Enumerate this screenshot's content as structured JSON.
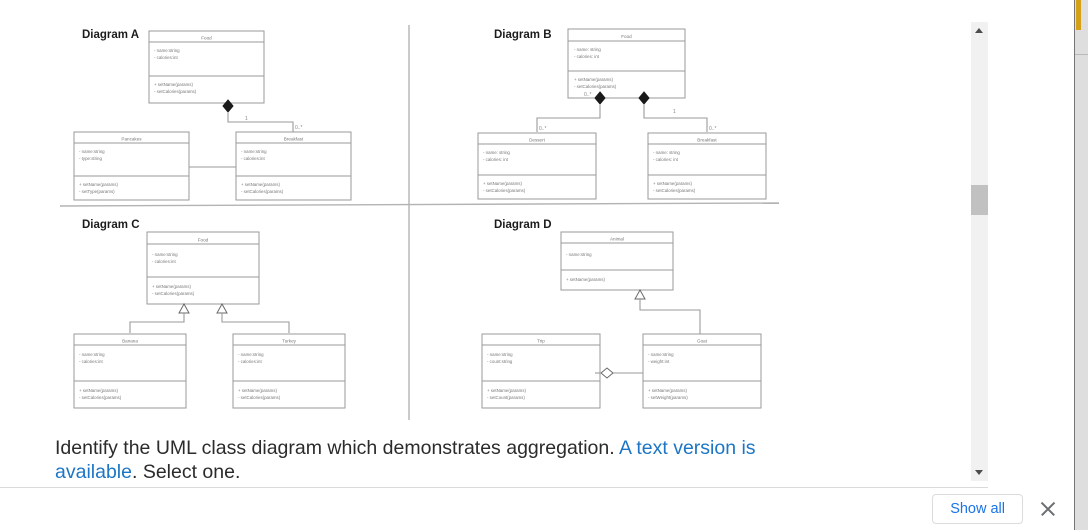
{
  "question": {
    "text_before": "Identify the UML class diagram which demonstrates aggregation. ",
    "link_text": "A text version is available",
    "text_after": ". Select one."
  },
  "bottom_bar": {
    "show_all_label": "Show all",
    "close_icon": "close-icon"
  },
  "scrollbar": {
    "up_icon": "scroll-up-arrow-icon",
    "down_icon": "scroll-down-arrow-icon"
  },
  "colors": {
    "link": "#1d76c5",
    "button_text": "#1a73e8",
    "diagram_stroke": "#808080",
    "text": "#2b2b2b",
    "scrollbar_track": "#f1f1f1",
    "scrollbar_thumb": "#c1c1c1",
    "find_marker": "#d4a017"
  },
  "figure": {
    "diagrams": [
      {
        "id": "A",
        "title": "Diagram A",
        "relationship": "composition",
        "classes": [
          {
            "name": "Food",
            "attributes": [
              "- name:string",
              "- calories:int"
            ],
            "methods": [
              "+ setName(params)",
              "- setCalories(params)"
            ]
          },
          {
            "name": "Pancakes",
            "attributes": [
              "- name:string",
              "- type:string"
            ],
            "methods": [
              "+ setName(params)",
              "- setType(params)"
            ]
          },
          {
            "name": "Breakfast",
            "attributes": [
              "- name:string",
              "- calories:int"
            ],
            "methods": [
              "+ setName(params)",
              "- setCalories(params)"
            ]
          }
        ],
        "multiplicities": [
          "1",
          "0..*"
        ]
      },
      {
        "id": "B",
        "title": "Diagram B",
        "relationship": "composition",
        "classes": [
          {
            "name": "Food",
            "attributes": [
              "- name: string",
              "- calories: int"
            ],
            "methods": [
              "+ setName(params)",
              "- setCalories(params)"
            ]
          },
          {
            "name": "Dessert",
            "attributes": [
              "- name: string",
              "- calories: int"
            ],
            "methods": [
              "+ setName(params)",
              "- setCalories(params)"
            ]
          },
          {
            "name": "Breakfast",
            "attributes": [
              "- name: string",
              "- calories: int"
            ],
            "methods": [
              "+ setName(params)",
              "- setCalories(params)"
            ]
          }
        ],
        "multiplicities": [
          "0..*",
          "0..*",
          "1",
          "0..*"
        ]
      },
      {
        "id": "C",
        "title": "Diagram C",
        "relationship": "inheritance",
        "classes": [
          {
            "name": "Food",
            "attributes": [
              "- name:string",
              "- calories:int"
            ],
            "methods": [
              "+ setName(params)",
              "- setCalories(params)"
            ]
          },
          {
            "name": "Banana",
            "attributes": [
              "- name:string",
              "- calories:int"
            ],
            "methods": [
              "+ setName(params)",
              "- setCalories(params)"
            ]
          },
          {
            "name": "Turkey",
            "attributes": [
              "- name:string",
              "- calories:int"
            ],
            "methods": [
              "+ setName(params)",
              "- setCalories(params)"
            ]
          }
        ],
        "multiplicities": []
      },
      {
        "id": "D",
        "title": "Diagram D",
        "relationship": "aggregation",
        "classes": [
          {
            "name": "Animal",
            "attributes": [
              "- name:string"
            ],
            "methods": [
              "+ setName(params)"
            ]
          },
          {
            "name": "Trip",
            "attributes": [
              "- name:string",
              "- count:string"
            ],
            "methods": [
              "+ setName(params)",
              "- setCount(params)"
            ]
          },
          {
            "name": "Goat",
            "attributes": [
              "- name:string",
              "- weight:int"
            ],
            "methods": [
              "+ setName(params)",
              "- setWeight(params)"
            ]
          }
        ],
        "multiplicities": []
      }
    ]
  }
}
